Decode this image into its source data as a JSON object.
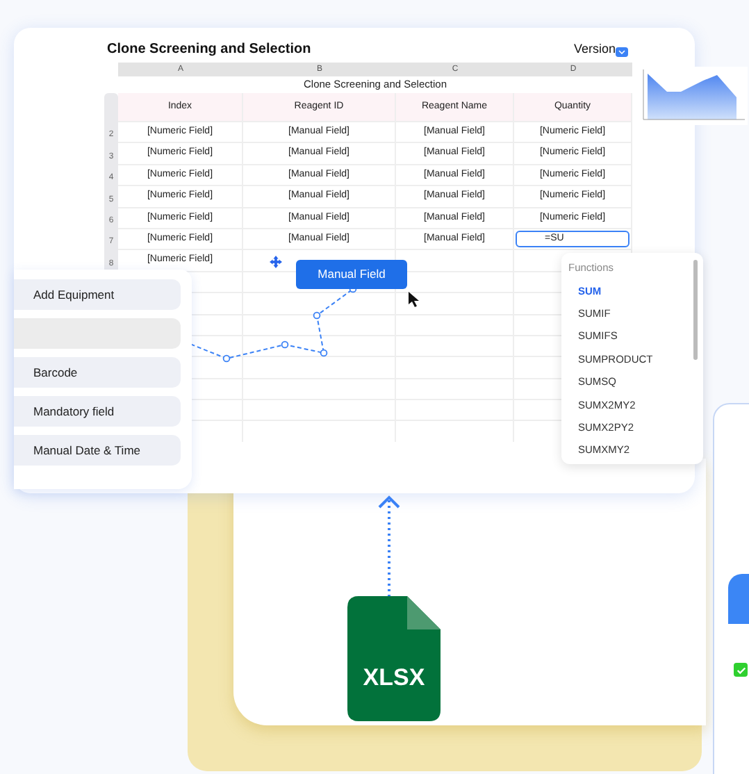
{
  "title": "Clone Screening and Selection",
  "version_label": "Version",
  "sheet": {
    "column_letters": [
      "A",
      "B",
      "C",
      "D"
    ],
    "title": "Clone Screening and Selection",
    "headers": [
      "Index",
      "Reagent ID",
      "Reagent Name",
      "Quantity"
    ],
    "rows": [
      {
        "number": "2",
        "cells": [
          "[Numeric Field]",
          "[Manual Field]",
          "[Manual Field]",
          "[Numeric Field]"
        ]
      },
      {
        "number": "3",
        "cells": [
          "[Numeric Field]",
          "[Manual Field]",
          "[Manual Field]",
          "[Numeric Field]"
        ]
      },
      {
        "number": "4",
        "cells": [
          "[Numeric Field]",
          "[Manual Field]",
          "[Manual Field]",
          "[Numeric Field]"
        ]
      },
      {
        "number": "5",
        "cells": [
          "[Numeric Field]",
          "[Manual Field]",
          "[Manual Field]",
          "[Numeric Field]"
        ]
      },
      {
        "number": "6",
        "cells": [
          "[Numeric Field]",
          "[Manual Field]",
          "[Manual Field]",
          "[Numeric Field]"
        ]
      },
      {
        "number": "7",
        "cells": [
          "[Numeric Field]",
          "[Manual Field]",
          "[Manual Field]"
        ],
        "input": "=SU"
      },
      {
        "number": "8",
        "cells": [
          "[Numeric Field]"
        ]
      }
    ]
  },
  "drag_button": "Manual Field",
  "field_menu": [
    {
      "kind": "item",
      "label": "Add Equipment"
    },
    {
      "kind": "blank"
    },
    {
      "kind": "item",
      "label": "Barcode"
    },
    {
      "kind": "item",
      "label": "Mandatory field"
    },
    {
      "kind": "item",
      "label": "Manual Date & Time"
    }
  ],
  "functions": {
    "heading": "Functions",
    "items": [
      {
        "label": "SUM",
        "selected": true
      },
      {
        "label": "SUMIF",
        "selected": false
      },
      {
        "label": "SUMIFS",
        "selected": false
      },
      {
        "label": "SUMPRODUCT",
        "selected": false
      },
      {
        "label": "SUMSQ",
        "selected": false
      },
      {
        "label": "SUMX2MY2",
        "selected": false
      },
      {
        "label": "SUMX2PY2",
        "selected": false
      },
      {
        "label": "SUMXMY2",
        "selected": false
      }
    ]
  },
  "file_badge": "XLSX",
  "side_card": {
    "checked": true
  }
}
